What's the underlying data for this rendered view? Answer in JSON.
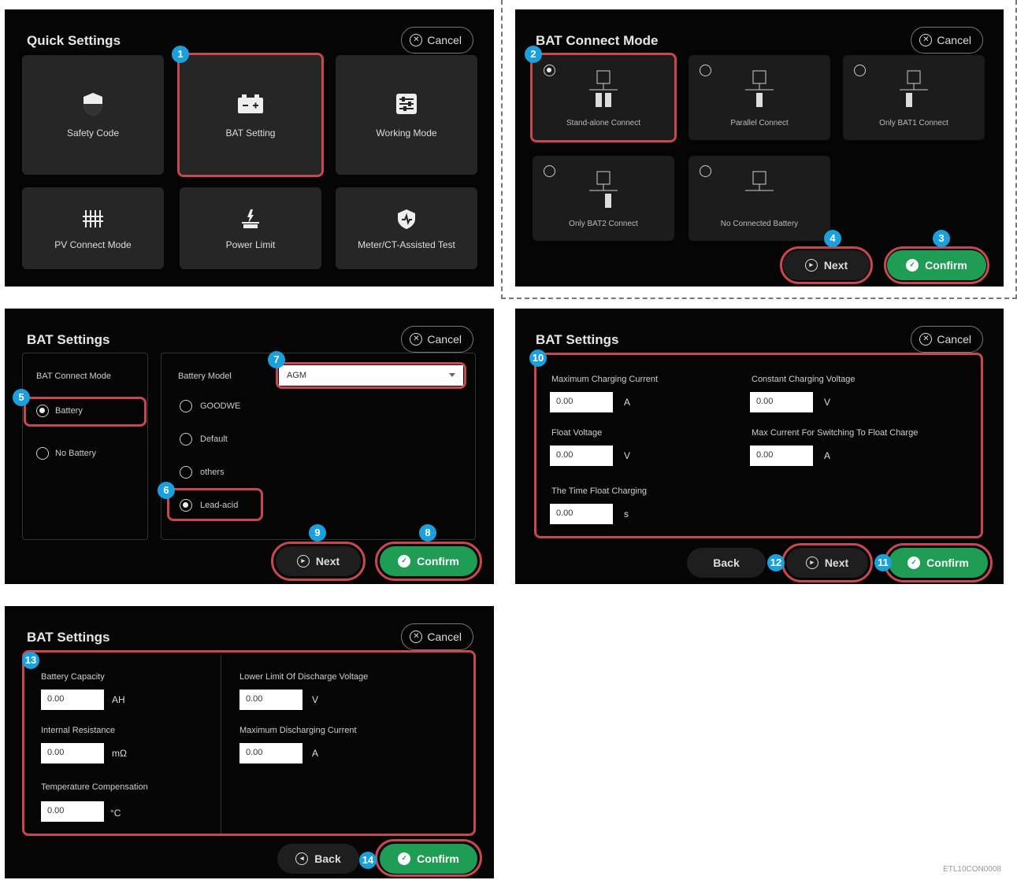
{
  "colors": {
    "highlight": "#c8484f",
    "badge": "#1aa0dc",
    "confirm": "#1f9d55",
    "panel_bg": "#050505",
    "tile_bg": "#262626"
  },
  "cancel_label": "Cancel",
  "quick": {
    "title": "Quick Settings",
    "tiles": [
      {
        "label": "Safety Code",
        "icon": "shield-icon"
      },
      {
        "label": "BAT Setting",
        "icon": "battery-icon"
      },
      {
        "label": "Working Mode",
        "icon": "sliders-icon"
      },
      {
        "label": "PV Connect Mode",
        "icon": "pv-connect-icon"
      },
      {
        "label": "Power Limit",
        "icon": "power-limit-icon"
      },
      {
        "label": "Meter/CT-Assisted Test",
        "icon": "meter-test-icon"
      }
    ]
  },
  "mode": {
    "title": "BAT Connect Mode",
    "options": [
      "Stand-alone Connect",
      "Parallel Connect",
      "Only BAT1 Connect",
      "Only BAT2 Connect",
      "No Connected Battery"
    ],
    "next_label": "Next",
    "confirm_label": "Confirm"
  },
  "bat1": {
    "title": "BAT Settings",
    "connect_mode_label": "BAT Connect Mode",
    "connect_options": [
      "Battery",
      "No Battery"
    ],
    "battery_model_label": "Battery Model",
    "battery_model_value": "AGM",
    "model_options": [
      "GOODWE",
      "Default",
      "others",
      "Lead-acid"
    ],
    "next_label": "Next",
    "confirm_label": "Confirm"
  },
  "bat2": {
    "title": "BAT Settings",
    "fields": [
      {
        "label": "Maximum Charging Current",
        "value": "0.00",
        "unit": "A"
      },
      {
        "label": "Constant Charging Voltage",
        "value": "0.00",
        "unit": "V"
      },
      {
        "label": "Float Voltage",
        "value": "0.00",
        "unit": "V"
      },
      {
        "label": "Max Current For Switching To Float Charge",
        "value": "0.00",
        "unit": "A"
      },
      {
        "label": "The Time Float Charging",
        "value": "0.00",
        "unit": "s"
      }
    ],
    "back_label": "Back",
    "next_label": "Next",
    "confirm_label": "Confirm"
  },
  "bat3": {
    "title": "BAT Settings",
    "fields": [
      {
        "label": "Battery Capacity",
        "value": "0.00",
        "unit": "AH"
      },
      {
        "label": "Lower Limit Of Discharge Voltage",
        "value": "0.00",
        "unit": "V"
      },
      {
        "label": "Internal Resistance",
        "value": "0.00",
        "unit": "mΩ"
      },
      {
        "label": "Maximum Discharging Current",
        "value": "0.00",
        "unit": "A"
      },
      {
        "label": "Temperature Compensation",
        "value": "0.00",
        "unit": "°C"
      }
    ],
    "back_label": "Back",
    "confirm_label": "Confirm"
  },
  "steps": [
    "1",
    "2",
    "3",
    "4",
    "5",
    "6",
    "7",
    "8",
    "9",
    "10",
    "11",
    "12",
    "13",
    "14"
  ],
  "figure_code": "ETL10CON0008"
}
